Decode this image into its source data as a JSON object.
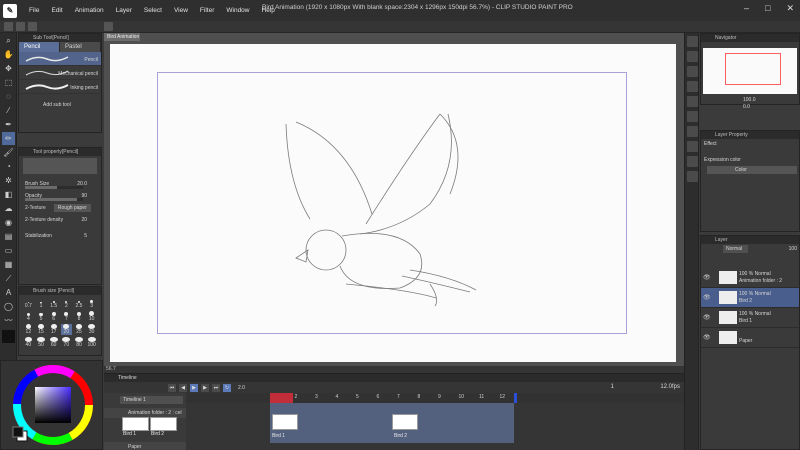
{
  "app": {
    "title": "Bird Animation (1920 x 1080px With blank space:2304 x 1296px 150dpi 56.7%)  - CLIP STUDIO PAINT PRO",
    "menu": [
      "File",
      "Edit",
      "Animation",
      "Layer",
      "Select",
      "View",
      "Filter",
      "Window",
      "Help"
    ],
    "window_controls": [
      "–",
      "□",
      "✕"
    ]
  },
  "canvas": {
    "tab": "Bird Animation",
    "zoom": "56.7"
  },
  "sub_tool": {
    "header": "Sub Tool[Pencil]",
    "tabs": [
      "Pencil",
      "Pastel"
    ],
    "items": [
      "Pencil",
      "Mechanical pencil",
      "Inking pencil"
    ],
    "add_label": "Add sub tool"
  },
  "tool_property": {
    "header": "Tool property[Pencil]",
    "brush_size_label": "Brush Size",
    "brush_size_value": "20.0",
    "brush_size_fraction": 0.55,
    "opacity_label": "Opacity",
    "opacity_value": "90",
    "opacity_fraction": 0.9,
    "texture_label": "2-Texture",
    "texture_value": "Rough paper",
    "texture_density_label": "2-Texture density",
    "texture_density_value": "20",
    "stabilization_label": "Stabilization",
    "stabilization_value": "5"
  },
  "brush_size": {
    "header": "Brush size [Pencil]",
    "sizes": [
      "0.7",
      "1",
      "1.5",
      "2",
      "2.5",
      "3",
      "4",
      "5",
      "6",
      "7",
      "8",
      "10",
      "12",
      "15",
      "17",
      "20",
      "25",
      "30",
      "40",
      "50",
      "60",
      "70",
      "80",
      "100"
    ],
    "selected": "20"
  },
  "timeline": {
    "header": "Timeline",
    "name_select": "Timeline 1",
    "folder_track": "Animation folder : 2 : cel",
    "paper_track": "Paper",
    "frame_numbers": [
      "1",
      "2",
      "3",
      "4",
      "5",
      "6",
      "7",
      "8",
      "9",
      "10",
      "11",
      "12"
    ],
    "current_frame": "1",
    "fps": "12.0fps",
    "cels": [
      "Bird 1",
      "Bird 2"
    ],
    "speed": "2.0"
  },
  "navigator": {
    "header": "Navigator",
    "zoom": "100.0",
    "rotate": "0.0"
  },
  "layer_property": {
    "header": "Layer Property",
    "effect_label": "Effect",
    "expression_label": "Expression color",
    "expression_value": "Color"
  },
  "layers": {
    "header": "Layer",
    "blend_mode": "Normal",
    "opacity": "100",
    "items": [
      {
        "line1": "100 % Normal",
        "line2": "Animation folder : 2",
        "selected": false
      },
      {
        "line1": "100 % Normal",
        "line2": "Bird 2",
        "selected": true
      },
      {
        "line1": "100 % Normal",
        "line2": "Bird 1",
        "selected": false
      },
      {
        "line1": "",
        "line2": "Paper",
        "selected": false
      }
    ]
  },
  "colors": {
    "accent": "#5a6e98",
    "playhead": "#c12d38",
    "frame_border": "#a7a3d6",
    "nav_rect": "#ff5e5e"
  }
}
